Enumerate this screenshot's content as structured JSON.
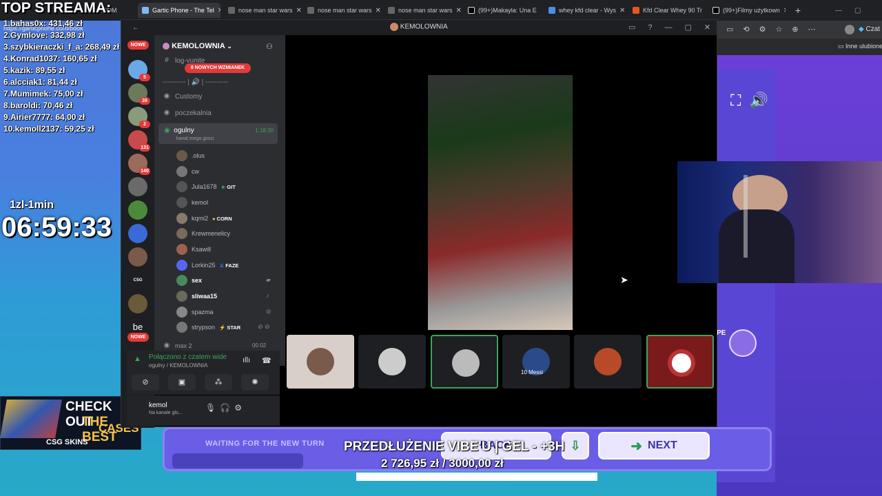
{
  "browser": {
    "tabs": [
      {
        "label": ".COM"
      },
      {
        "label": "Gartic Phone - The Tel"
      },
      {
        "label": "nose man star wars"
      },
      {
        "label": "nose man star wars"
      },
      {
        "label": "nose man star wars"
      },
      {
        "label": "(99+)Makayla: Una E"
      },
      {
        "label": "whey kfd clear - Wys"
      },
      {
        "label": "Kfd Clear Whey 90 Tr"
      },
      {
        "label": "(99+)Filmy użytkown"
      }
    ],
    "url": "https://garticphone.com/book",
    "bookmark": "Inne ulubione",
    "profile_label": "Czat"
  },
  "overlay": {
    "title": "TOP STREAMA:",
    "donors": [
      "1.bahas0x: 431,46 zł",
      "2.Gymlove: 332,98 zł",
      "3.szybkieraczki_f_a: 268,49 zł",
      "4.Konrad1037: 160,65 zł",
      "5.kazik: 89,55 zł",
      "6.alcciak1: 81,44 zł",
      "7.Mumimek: 75,00 zł",
      "8.baroldi: 70,46 zł",
      "9.Airier7777: 64,00 zł",
      "10.kemoll2137: 59,25 zł"
    ],
    "rate": "1zl-1min",
    "timer": "06:59:33",
    "ad_line1": "CHECK OUT",
    "ad_line2": "THE BEST",
    "ad_line3": "CASES",
    "ad_brand": "CSG SKINS",
    "prolong": "PRZEDŁUŻENIE VIBE'U | GEL - +3H",
    "goal": "2 726,95 zł  /  3000,00 zł",
    "goal_progress": 0.909
  },
  "discord": {
    "window_title": "KEMOLOWNIA",
    "server_name": "KEMOLOWNIA",
    "mention_banner": "8 NOWYCH WZMIANEK",
    "nowe": "NOWE",
    "servers": [
      {
        "badge": "5"
      },
      {
        "badge": "26"
      },
      {
        "badge": "2"
      },
      {
        "badge": "131"
      },
      {
        "badge": "140"
      },
      {
        "badge": ""
      },
      {
        "badge": ""
      },
      {
        "badge": ""
      },
      {
        "badge": ""
      },
      {
        "badge": "CSG SKINS"
      },
      {
        "badge": ""
      },
      {
        "badge": "be"
      }
    ],
    "channels": [
      {
        "name": "log-vunite",
        "type": "text"
      },
      {
        "name": "---------- | 🔊 | ----------",
        "type": "category"
      },
      {
        "name": "Customy",
        "type": "voice"
      },
      {
        "name": "poczekalnia",
        "type": "voice"
      },
      {
        "name": "ogulny",
        "type": "voice",
        "active": true,
        "time": "1:18:30",
        "subtitle": "kanal mega gosci"
      }
    ],
    "members": [
      {
        "name": ".olus"
      },
      {
        "name": "cw"
      },
      {
        "name": "Jula1678",
        "tag": "GIT"
      },
      {
        "name": "kemol"
      },
      {
        "name": "kqmi2",
        "tag": "CORN"
      },
      {
        "name": "Krewmenelicy"
      },
      {
        "name": "Ksawill"
      },
      {
        "name": "Lorkin25",
        "tag": "FAZE"
      },
      {
        "name": "sex",
        "bold": true
      },
      {
        "name": "sliwaa15",
        "bold": true
      },
      {
        "name": "spazma"
      },
      {
        "name": "strypson",
        "tag": "STAR"
      }
    ],
    "next_channel": "max 2",
    "next_channel_time": "00 02",
    "voice_status": "Połączono z czatem wide",
    "voice_location": "ogulny / KEMOLOWNIA",
    "user_name": "kemol",
    "user_status": "Na kanale glo...",
    "tiles": [
      {
        "label": ""
      },
      {
        "label": ""
      },
      {
        "label": ""
      },
      {
        "label": "10 Messi"
      },
      {
        "label": ""
      },
      {
        "label": ""
      }
    ]
  },
  "game": {
    "waiting": "WAITING FOR THE NEW TURN",
    "back": "BACK",
    "next": "NEXT",
    "pe": "PE"
  }
}
